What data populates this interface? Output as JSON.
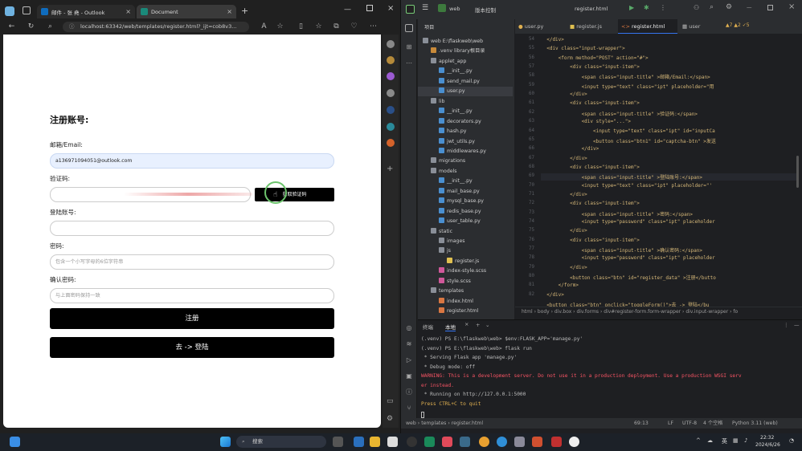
{
  "browser": {
    "tabs": [
      {
        "label": "邮件 - 张 堯 - Outlook",
        "color": "#0f6cbd"
      },
      {
        "label": "Document",
        "color": "#3a3a3a"
      }
    ],
    "address": "localhost:63342/web/templates/register.html?_ijt=cob8v3...",
    "page": {
      "heading": "注册账号:",
      "email_label": "邮箱/Email:",
      "email_value": "a136971094051@outlook.com",
      "captcha_label": "验证码:",
      "captcha_button": "获取验证码",
      "account_label": "登陆账号:",
      "password_label": "密码:",
      "password_placeholder": "包含一个小写字母的6位字符串",
      "confirm_label": "确认密码:",
      "confirm_placeholder": "与上面密码保持一致",
      "register_button": "注册",
      "login_button": "去 -> 登陆"
    }
  },
  "ide": {
    "project_name": "web",
    "vcs_label": "版本控制",
    "run_config": "register.html",
    "project_label": "项目",
    "tabs": [
      "user.py",
      "register.js",
      "register.html",
      "user"
    ],
    "inspections": {
      "warnings": "7",
      "weak": "2",
      "typos": "5"
    },
    "tree": [
      {
        "label": "web  E:\\flaskweb\\web",
        "depth": 0,
        "icon": "folder"
      },
      {
        "label": ".venv  library根目录",
        "depth": 1,
        "icon": "folder-orange"
      },
      {
        "label": "applet_app",
        "depth": 1,
        "icon": "folder"
      },
      {
        "label": "__init__.py",
        "depth": 2,
        "icon": "py"
      },
      {
        "label": "send_mail.py",
        "depth": 2,
        "icon": "py"
      },
      {
        "label": "user.py",
        "depth": 2,
        "icon": "py"
      },
      {
        "label": "lib",
        "depth": 1,
        "icon": "folder"
      },
      {
        "label": "__init__.py",
        "depth": 2,
        "icon": "py"
      },
      {
        "label": "decorators.py",
        "depth": 2,
        "icon": "py"
      },
      {
        "label": "hash.py",
        "depth": 2,
        "icon": "py"
      },
      {
        "label": "jwt_utils.py",
        "depth": 2,
        "icon": "py"
      },
      {
        "label": "middlewares.py",
        "depth": 2,
        "icon": "py"
      },
      {
        "label": "migrations",
        "depth": 1,
        "icon": "folder"
      },
      {
        "label": "models",
        "depth": 1,
        "icon": "folder"
      },
      {
        "label": "__init__.py",
        "depth": 2,
        "icon": "py"
      },
      {
        "label": "mail_base.py",
        "depth": 2,
        "icon": "py"
      },
      {
        "label": "mysql_base.py",
        "depth": 2,
        "icon": "py"
      },
      {
        "label": "redis_base.py",
        "depth": 2,
        "icon": "py"
      },
      {
        "label": "user_table.py",
        "depth": 2,
        "icon": "py"
      },
      {
        "label": "static",
        "depth": 1,
        "icon": "folder"
      },
      {
        "label": "images",
        "depth": 2,
        "icon": "folder"
      },
      {
        "label": "js",
        "depth": 2,
        "icon": "folder"
      },
      {
        "label": "register.js",
        "depth": 3,
        "icon": "js"
      },
      {
        "label": "index-style.scss",
        "depth": 2,
        "icon": "scss"
      },
      {
        "label": "style.scss",
        "depth": 2,
        "icon": "scss"
      },
      {
        "label": "templates",
        "depth": 1,
        "icon": "folder"
      },
      {
        "label": "index.html",
        "depth": 2,
        "icon": "html"
      },
      {
        "label": "register.html",
        "depth": 2,
        "icon": "html"
      }
    ],
    "line_numbers": [
      "54",
      "55",
      "56",
      "57",
      "58",
      "59",
      "60",
      "61",
      "62",
      "63",
      "64",
      "65",
      "66",
      "67",
      "68",
      "69",
      "70",
      "71",
      "72",
      "73",
      "74",
      "75",
      "76",
      "77",
      "78",
      "79",
      "80",
      "81",
      "82"
    ],
    "code_lines": [
      "  </div>",
      "  <div class=\"input-wrapper\">",
      "      <form method=\"POST\" action=\"#\">",
      "          <div class=\"input-item\">",
      "              <span class=\"input-title\" >邮箱/Email:</span>",
      "              <input type=\"text\" class=\"ipt\" placeholder=\"用",
      "          </div>",
      "          <div class=\"input-item\">",
      "              <span class=\"input-title\" >验证码:</span>",
      "              <div style=\"...\">",
      "                  <input type=\"text\" class=\"ipt\" id=\"inputCa",
      "                  <button class=\"btn1\" id=\"captcha-btn\" >发送",
      "              </div>",
      "          </div>",
      "          <div class=\"input-item\">",
      "              <span class=\"input-title\" >登陆账号:</span>",
      "              <input type=\"text\" class=\"ipt\" placeholder=\"'",
      "          </div>",
      "          <div class=\"input-item\">",
      "              <span class=\"input-title\" >密码:</span>",
      "              <input type=\"password\" class=\"ipt\" placeholder",
      "          </div>",
      "          <div class=\"input-item\">",
      "              <span class=\"input-title\" >确认密码:</span>",
      "              <input type=\"password\" class=\"ipt\" placeholder",
      "          </div>",
      "          <button class=\"btn\" id=\"register_data\" >注册</butto",
      "      </form>",
      "  </div>"
    ],
    "last_line": "  <button class=\"btn\" onclick=\"toggleForm()\">去 -> 登陆</bu",
    "breadcrumb": "html  ›  body  ›  div.box  ›  div.forms  ›  div#register-form.form-wrapper  ›  div.input-wrapper  ›  fo",
    "terminal": {
      "tab_terminal": "终端",
      "tab_local": "本地",
      "lines": [
        {
          "text": "(.venv) PS E:\\flaskweb\\web> $env:FLASK_APP='manage.py'",
          "color": "#bbb"
        },
        {
          "text": "(.venv) PS E:\\flaskweb\\web> flask run",
          "color": "#bbb"
        },
        {
          "text": " * Serving Flask app 'manage.py'",
          "color": "#bbb"
        },
        {
          "text": " * Debug mode: off",
          "color": "#bbb"
        },
        {
          "text": "WARNING: This is a development server. Do not use it in a production deployment. Use a production WSGI serv",
          "color": "#f75464"
        },
        {
          "text": "er instead.",
          "color": "#f75464"
        },
        {
          "text": " * Running on http://127.0.0.1:5000",
          "color": "#bbb"
        },
        {
          "text": "Press CTRL+C to quit",
          "color": "#e0b050"
        }
      ]
    },
    "status": {
      "path": "web  ›  templates  ›  register.html",
      "position": "69:13",
      "line_sep": "LF",
      "encoding": "UTF-8",
      "indent": "4 个空格",
      "interpreter": "Python 3.11 (web)"
    }
  },
  "taskbar": {
    "search": "搜索",
    "time": "22:32",
    "date": "2024/6/26",
    "ime": "英"
  }
}
